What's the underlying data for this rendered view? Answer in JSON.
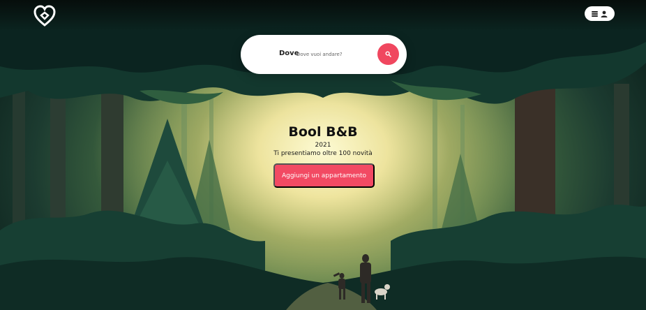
{
  "header": {
    "logo_icon": "heart-outline-logo",
    "menu_icon": "hamburger-icon",
    "user_icon": "user-icon"
  },
  "search": {
    "label": "Dove",
    "placeholder": "Dove vuoi andare?",
    "button_icon": "search-icon"
  },
  "hero": {
    "title": "Bool B&B",
    "year": "2021",
    "subtitle": "Ti presentiamo oltre 100 novità",
    "cta_label": "Aggiungi un appartamento"
  },
  "colors": {
    "accent": "#f24a63",
    "white": "#ffffff"
  }
}
